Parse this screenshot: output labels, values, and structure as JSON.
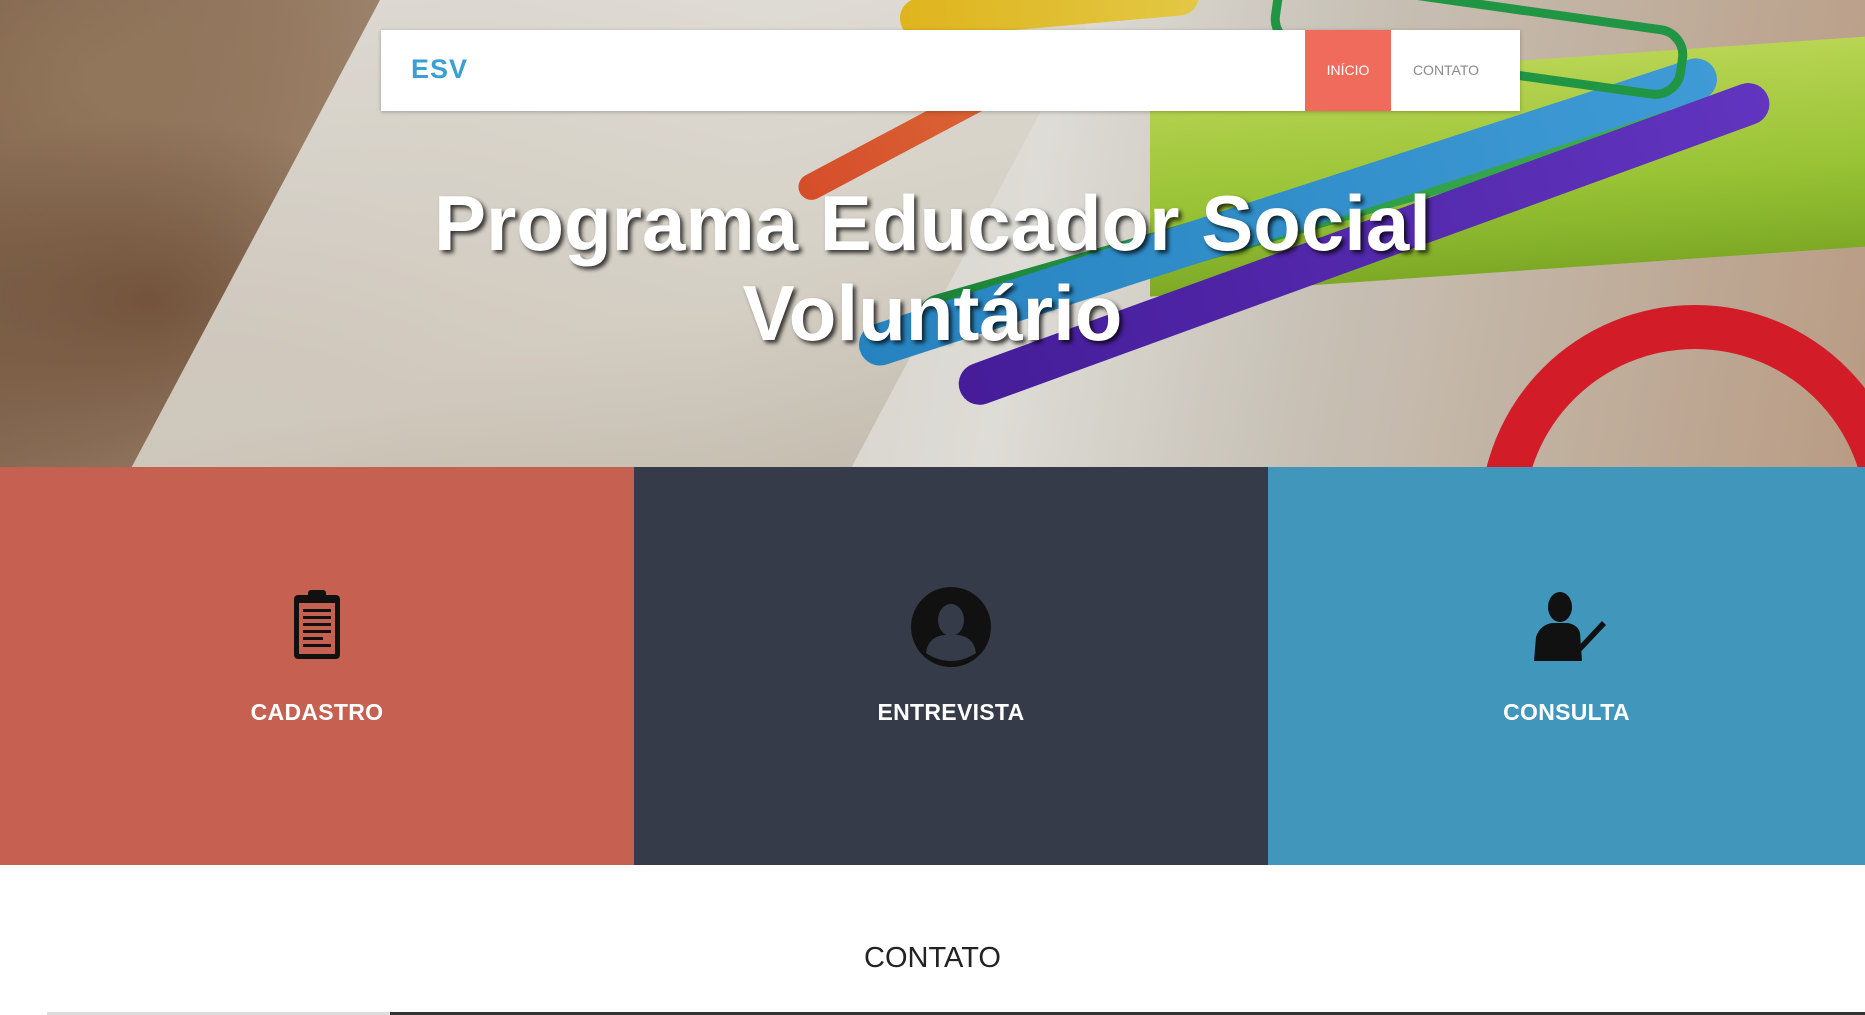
{
  "navbar": {
    "brand": "ESV",
    "items": [
      {
        "label": "INÍCIO",
        "active": true
      },
      {
        "label": "CONTATO",
        "active": false
      }
    ]
  },
  "hero": {
    "title_line1": "Programa Educador Social",
    "title_line2": "Voluntário"
  },
  "tiles": [
    {
      "label": "CADASTRO",
      "icon": "clipboard-icon",
      "color": "#c66152"
    },
    {
      "label": "ENTREVISTA",
      "icon": "user-silhouette-icon",
      "color": "#363b4a"
    },
    {
      "label": "CONSULTA",
      "icon": "user-check-icon",
      "color": "#4196bb"
    }
  ],
  "sections": {
    "contato_title": "CONTATO"
  },
  "colors": {
    "brand": "#3a9fd4",
    "nav_active": "#f06b5b"
  }
}
